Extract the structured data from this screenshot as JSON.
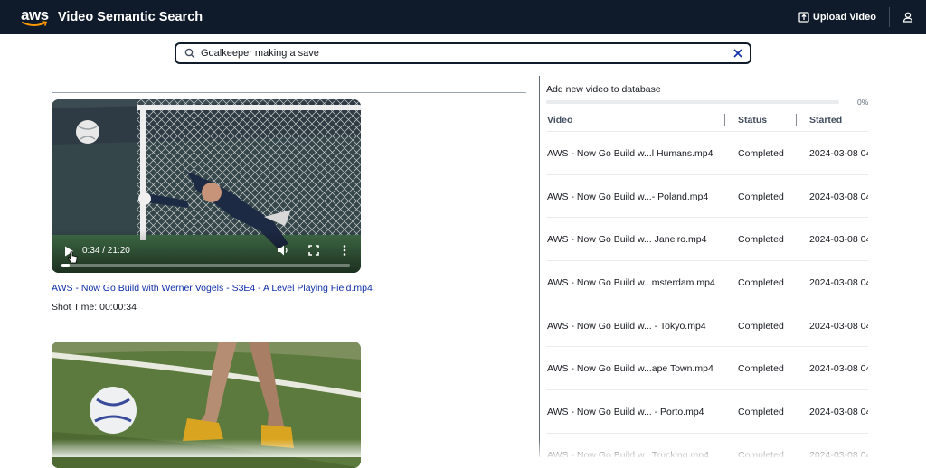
{
  "nav": {
    "logo_text": "aws",
    "app_title": "Video Semantic Search",
    "upload_label": "Upload Video",
    "upload_icon": "upload-icon",
    "user_icon": "user-profile-icon"
  },
  "search": {
    "value": "Goalkeeper making a save",
    "search_icon": "search-icon",
    "clear_icon": "clear-icon"
  },
  "results": [
    {
      "time_display": "0:34 / 21:20",
      "progress": 0.027,
      "title": "AWS - Now Go Build with Werner Vogels - S3E4 - A Level Playing Field.mp4",
      "shot_time": "Shot Time: 00:00:34"
    }
  ],
  "upload_panel": {
    "title": "Add new video to database",
    "progress_percent": 0,
    "progress_label": "0%"
  },
  "table": {
    "columns": [
      "Video",
      "Status",
      "Started"
    ],
    "rows": [
      {
        "video": "AWS - Now Go Build w...l Humans.mp4",
        "status": "Completed",
        "started": "2024-03-08 04"
      },
      {
        "video": "AWS - Now Go Build w...- Poland.mp4",
        "status": "Completed",
        "started": "2024-03-08 04"
      },
      {
        "video": "AWS - Now Go Build w... Janeiro.mp4",
        "status": "Completed",
        "started": "2024-03-08 04"
      },
      {
        "video": "AWS - Now Go Build w...msterdam.mp4",
        "status": "Completed",
        "started": "2024-03-08 04"
      },
      {
        "video": "AWS - Now Go Build w... - Tokyo.mp4",
        "status": "Completed",
        "started": "2024-03-08 04"
      },
      {
        "video": "AWS - Now Go Build w...ape Town.mp4",
        "status": "Completed",
        "started": "2024-03-08 04"
      },
      {
        "video": "AWS - Now Go Build w... - Porto.mp4",
        "status": "Completed",
        "started": "2024-03-08 04"
      },
      {
        "video": "AWS - Now Go Build w...Trucking.mp4",
        "status": "Completed",
        "started": "2024-03-08 04"
      }
    ]
  },
  "colors": {
    "nav_bg": "#0f1b2a",
    "link": "#0f2fa8",
    "progress": "#0972d3"
  }
}
